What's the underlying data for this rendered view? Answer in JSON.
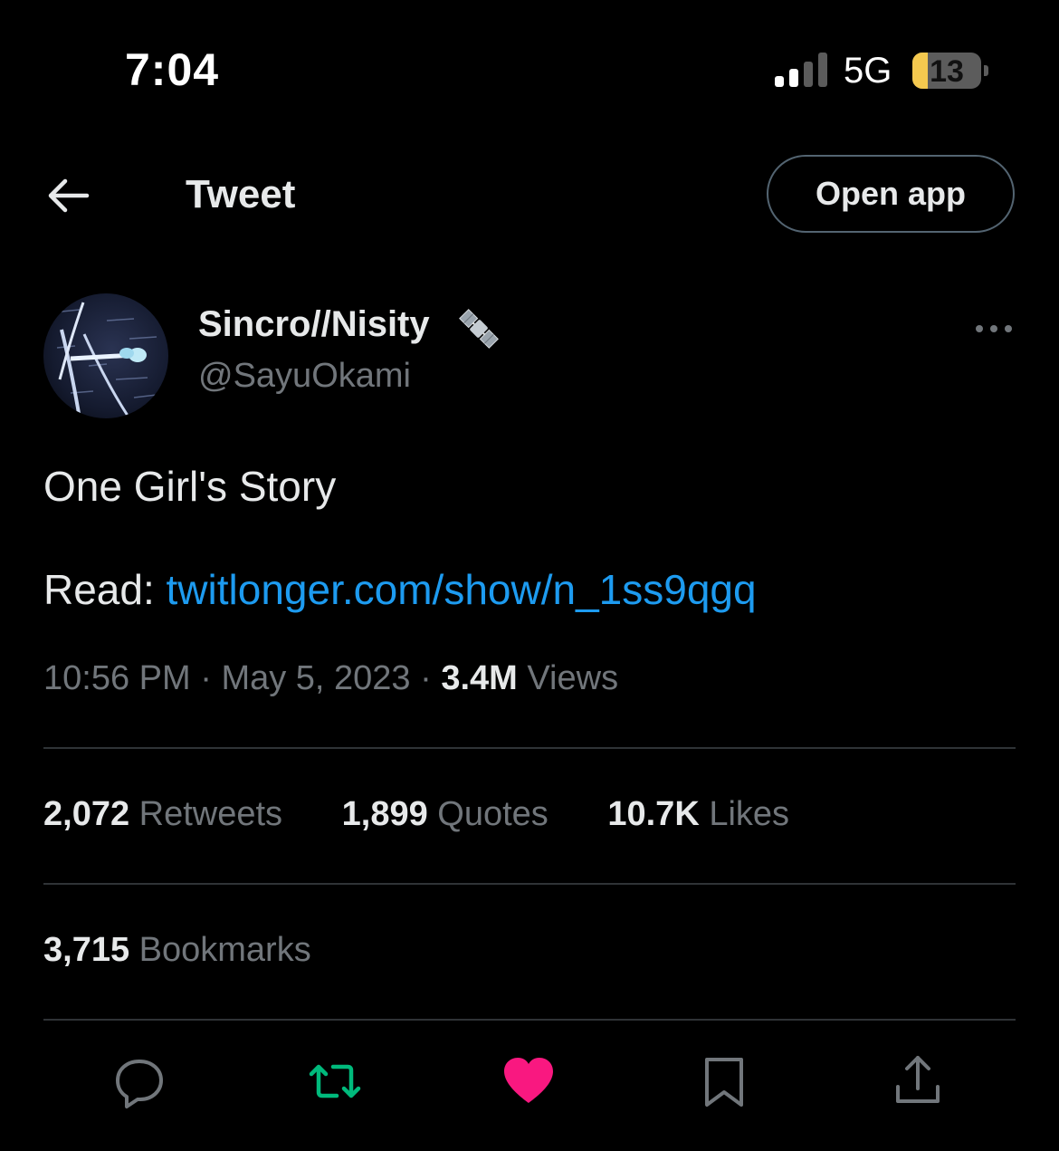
{
  "status_bar": {
    "time": "7:04",
    "network": "5G",
    "battery_level": "13",
    "battery_color": "#f4c94f"
  },
  "header": {
    "title": "Tweet",
    "back_icon": "arrow-left-icon",
    "open_app_label": "Open app"
  },
  "author": {
    "display_name": "Sincro//Nisity",
    "badge_icon": "satellite-icon",
    "handle": "@SayuOkami",
    "more_icon": "more-horizontal-icon"
  },
  "tweet": {
    "text": "One Girl's Story",
    "read_label": "Read: ",
    "link_text": "twitlonger.com/show/n_1ss9qgq",
    "link_color": "#1d9bf0",
    "time": "10:56 PM",
    "separator": " · ",
    "date": "May 5, 2023",
    "views_count": "3.4M",
    "views_label": " Views"
  },
  "stats": {
    "retweets_count": "2,072",
    "retweets_label": " Retweets",
    "quotes_count": "1,899",
    "quotes_label": " Quotes",
    "likes_count": "10.7K",
    "likes_label": " Likes",
    "bookmarks_count": "3,715",
    "bookmarks_label": " Bookmarks"
  },
  "actions": {
    "reply_icon": "reply-icon",
    "retweet_icon": "retweet-icon",
    "retweet_color": "#00ba7c",
    "like_icon": "heart-icon",
    "like_color": "#f91880",
    "bookmark_icon": "bookmark-icon",
    "share_icon": "share-icon"
  }
}
